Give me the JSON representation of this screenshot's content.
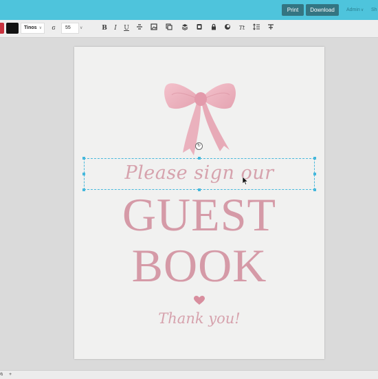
{
  "topbar": {
    "print_label": "Print",
    "download_label": "Download",
    "admin_label": "Admin",
    "share_label": "Sh"
  },
  "toolbar": {
    "colors": {
      "secondary": "#c8323e",
      "text_color": "#111111"
    },
    "font_name": "Tinos",
    "font_size": "55",
    "icons": [
      "font-style-icon",
      "bold-icon",
      "italic-icon",
      "underline-icon",
      "vertical-align-icon",
      "image-icon",
      "duplicate-icon",
      "layers-icon",
      "paste-icon",
      "lock-icon",
      "effects-icon",
      "text-case-icon",
      "line-height-icon",
      "clear-format-icon"
    ],
    "bold": "B",
    "italic": "I",
    "underline": "U",
    "text_case": "Tt"
  },
  "document": {
    "subtitle": "Please sign our",
    "title_line1": "GUEST",
    "title_line2": "BOOK",
    "closing": "Thank you!",
    "accent_color": "#d59aa7"
  },
  "bottombar": {
    "zoom_label": "%",
    "add_label": "+"
  }
}
